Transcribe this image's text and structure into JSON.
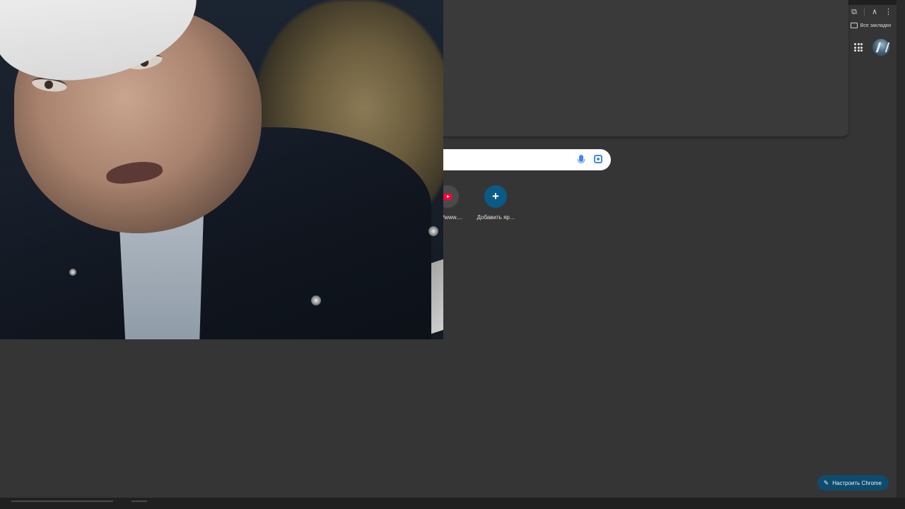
{
  "browser": {
    "bookmarks_label": "Все закладки"
  },
  "new_tab_page": {
    "shortcuts": [
      {
        "label": "/www....",
        "icon": "youtube-icon"
      },
      {
        "label": "Добавить яр...",
        "icon": "plus-icon"
      }
    ],
    "customize_label": "Настроить Chrome"
  },
  "colors": {
    "page_background": "#353535",
    "customize_button": "#0e4b6d",
    "add_shortcut": "#0b5a86"
  }
}
